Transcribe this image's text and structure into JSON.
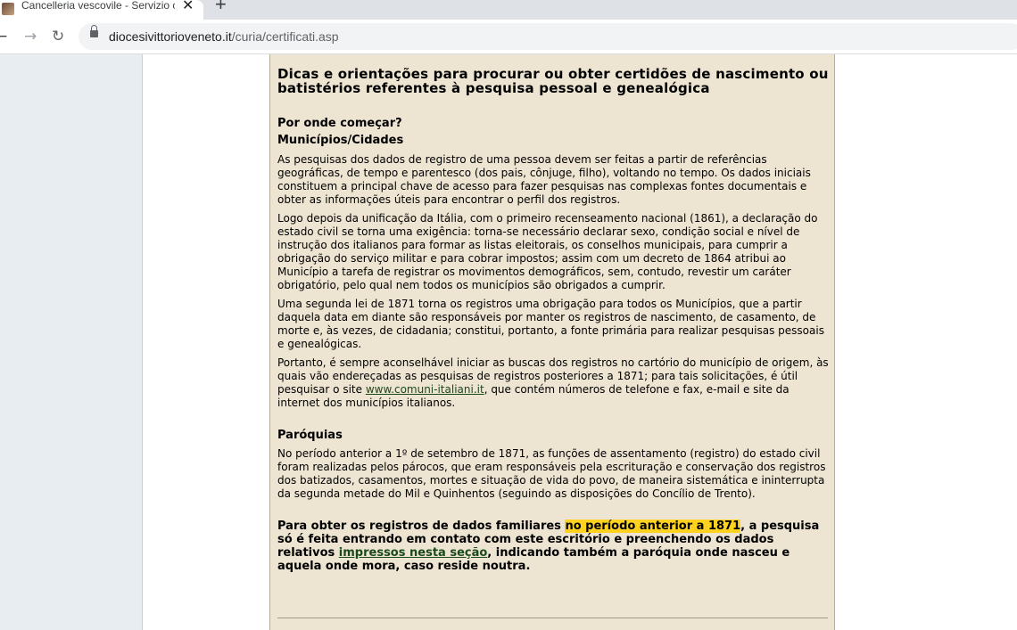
{
  "browser": {
    "tab_title": "Cancelleria vescovile - Servizio ce",
    "close_glyph": "✕",
    "new_tab_glyph": "+",
    "url_domain": "diocesivittorioveneto.it",
    "url_path": "/curia/certificati.asp",
    "back_glyph": "←",
    "forward_glyph": "→",
    "reload_glyph": "↻"
  },
  "article": {
    "title": "Dicas e orientações para procurar ou obter certidões de nascimento ou batistérios referentes à pesquisa pessoal e genealógica",
    "section1_heading": "Por onde começar?",
    "section1_subheading": "Municípios/Cidades",
    "p1": "As pesquisas dos dados de registro de uma pessoa devem ser feitas a partir de referências geográficas, de tempo e parentesco (dos pais, cônjuge, filho), voltando no tempo. Os dados iniciais constituem a principal chave de acesso para fazer pesquisas nas complexas fontes documentais e obter as informações úteis para encontrar o perfil dos registros.",
    "p2": "Logo depois da unificação da Itália, com o primeiro recenseamento nacional (1861), a declaração do estado civil se torna uma exigência: torna-se necessário declarar sexo, condição social e nível de instrução dos italianos para formar as listas eleitorais, os conselhos municipais, para cumprir a obrigação do serviço militar e para cobrar impostos; assim com um decreto de 1864 atribui ao Município  a tarefa de registrar os movimentos demográficos, sem, contudo, revestir um caráter obrigatório, pelo qual nem todos os municípios são obrigados a cumprir.",
    "p3": "Uma segunda lei de 1871 torna os registros uma obrigação para todos os Municípios, que a partir daquela data em diante são responsáveis por manter os registros de nascimento, de casamento, de morte e, às vezes, de cidadania; constitui, portanto, a fonte primária para realizar pesquisas pessoais e genealógicas.",
    "p4_before": "Portanto, é sempre aconselhável iniciar as buscas dos registros no cartório do município de origem, às quais vão endereçadas as pesquisas de registros posteriores a 1871; para tais solicitações, é útil pesquisar o site ",
    "p4_link": "www.comuni-italiani.it",
    "p4_after": ", que contém números de telefone e fax, e-mail e site da internet dos municípios italianos.",
    "section2_heading": "Paróquias",
    "p5": "No período anterior a 1º de setembro de 1871, as funções de assentamento (registro) do estado civil foram realizadas pelos párocos, que eram responsáveis pela escrituração e conservação dos registros dos batizados, casamentos, mortes e situação de vida do povo, de maneira sistemática e ininterrupta da segunda metade do Mil e Quinhentos (seguindo as disposições do Concílio de Trento).",
    "p6_before": "Para obter os registros de dados familiares ",
    "p6_highlight": "no período anterior a 1871",
    "p6_middle": ", a pesquisa só é feita entrando em contato com este escritório e preenchendo os dados relativos ",
    "p6_link": "impressos nesta seção",
    "p6_after": ", indicando também a paróquia onde nasceu e aquela onde mora, caso reside noutra."
  }
}
